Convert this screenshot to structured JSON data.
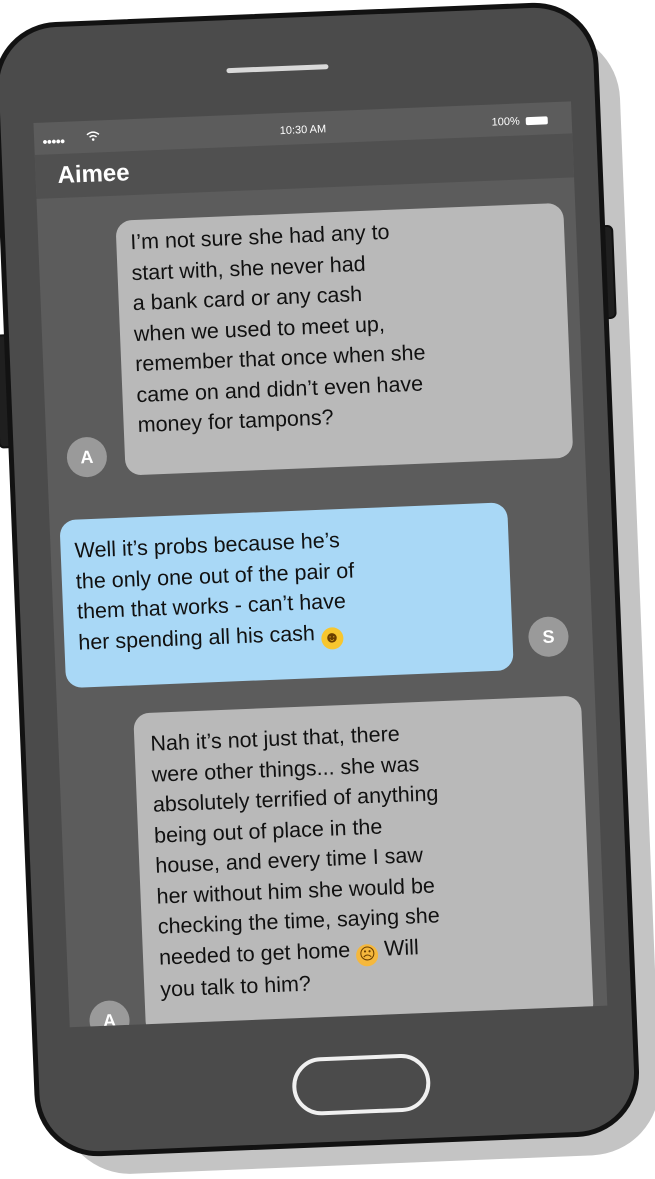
{
  "status_bar": {
    "signal": "●●●●●",
    "wifi_icon": "wifi-icon",
    "time": "10:30 AM",
    "battery": "100%"
  },
  "header": {
    "contact_name": "Aimee"
  },
  "messages": [
    {
      "sender": "A",
      "direction": "incoming",
      "lines": [
        "I’m not sure she had any to",
        "start with, she never had",
        "a bank card or any cash",
        "when we used to meet up,",
        "remember that once when she",
        "came on and didn’t even have",
        "money for tampons?"
      ]
    },
    {
      "sender": "S",
      "direction": "outgoing",
      "lines": [
        "Well it’s probs because he’s",
        "the only one out of the pair of",
        "them that works - can’t have",
        "her spending all his cash"
      ],
      "emoji": "face-with-tears-of-joy"
    },
    {
      "sender": "A",
      "direction": "incoming",
      "lines": [
        "Nah it’s not just that, there",
        "were other things... she was",
        "absolutely terrified of anything",
        "being out of place in the",
        "house, and every time I saw",
        "her without him she would be",
        "checking the time, saying she",
        "needed to get home",
        "you talk to him?"
      ],
      "emoji": "worried-face",
      "after_emoji": "Will"
    }
  ],
  "colors": {
    "incoming_bubble": "#b9b9b9",
    "outgoing_bubble": "#a9d8f6",
    "screen": "#5c5c5c",
    "phone_body": "#4b4b4b"
  }
}
